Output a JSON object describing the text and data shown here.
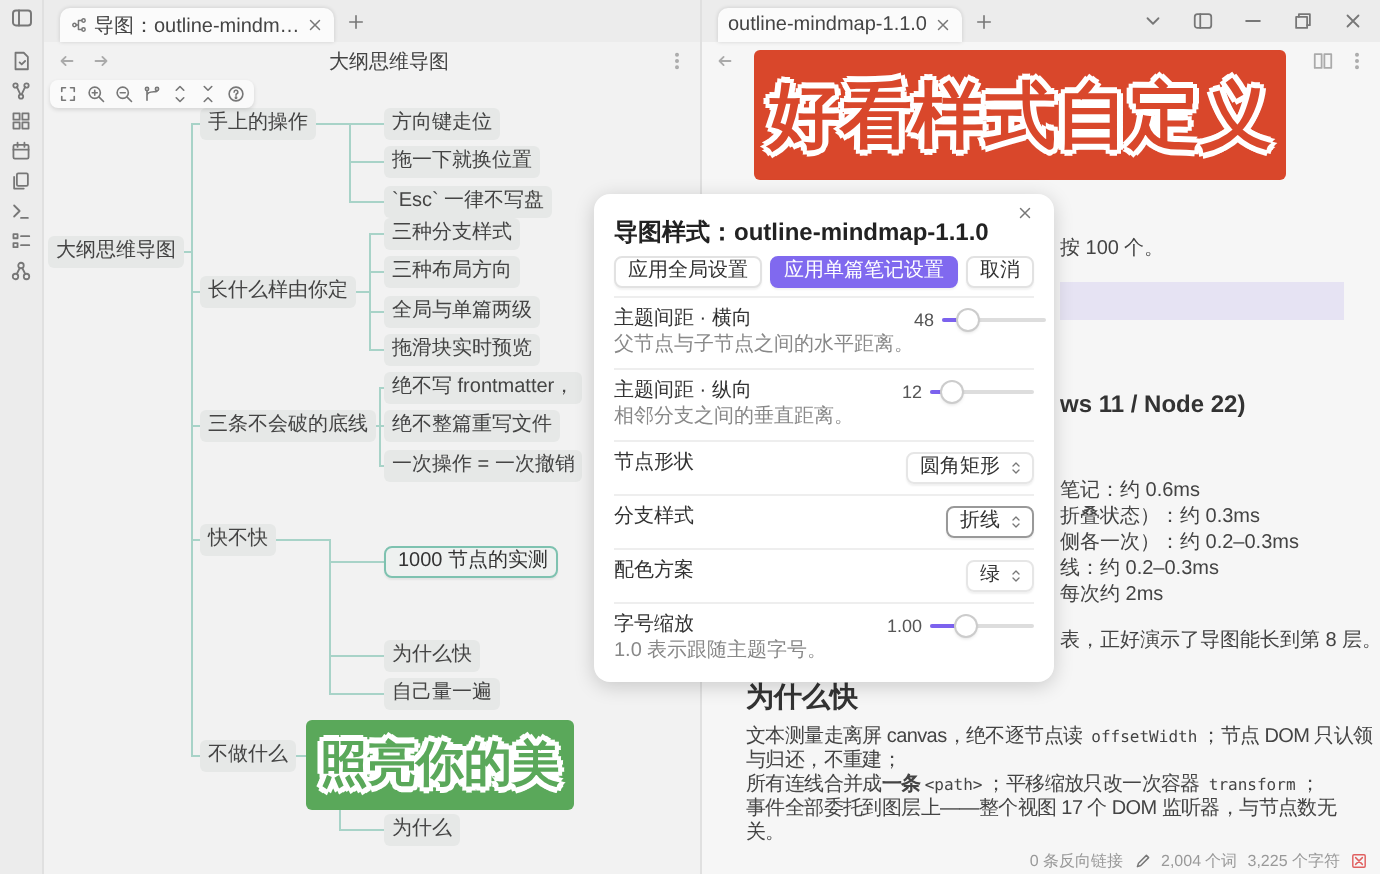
{
  "left_tabs": [
    {
      "title": "导图：outline-mindm…",
      "selected": true
    }
  ],
  "left_header": {
    "title": "大纲思维导图"
  },
  "mindmap": {
    "text": "大纲思维导图",
    "selected": false,
    "children": [
      {
        "text": "手上的操作",
        "selected": false,
        "children": [
          {
            "text": "方向键走位",
            "selected": false
          },
          {
            "text": "拖一下就换位置",
            "selected": false
          },
          {
            "text": "`Esc` 一律不写盘",
            "selected": false
          }
        ]
      },
      {
        "text": "长什么样由你定",
        "selected": false,
        "children": [
          {
            "text": "三种分支样式",
            "selected": false
          },
          {
            "text": "三种布局方向",
            "selected": false
          },
          {
            "text": "全局与单篇两级",
            "selected": false
          },
          {
            "text": "拖滑块实时预览",
            "selected": false
          }
        ]
      },
      {
        "text": "三条不会破的底线",
        "selected": false,
        "children": [
          {
            "text": "绝不写 frontmatter，",
            "selected": false
          },
          {
            "text": "绝不整篇重写文件",
            "selected": false
          },
          {
            "text": "一次操作 = 一次撤销",
            "selected": false
          }
        ]
      },
      {
        "text": "快不快",
        "selected": false,
        "children": [
          {
            "text": "1000 节点的实测",
            "selected": true
          },
          {
            "text": "为什么快",
            "selected": false
          },
          {
            "text": "自己量一遍",
            "selected": false
          }
        ]
      },
      {
        "text": "不做什么",
        "selected": false,
        "children": [
          {
            "text": "为什么",
            "selected": false
          }
        ]
      }
    ]
  },
  "right_tabs": [
    {
      "title": "outline-mindmap-1.1.0",
      "selected": true
    }
  ],
  "note": {
    "intro": "按 100 个。",
    "subheading": "ws 11 / Node 22)",
    "lines": [
      "笔记：约 0.6ms",
      "折叠状态）：约 0.3ms",
      "侧各一次）：约 0.2–0.3ms",
      "线：约 0.2–0.3ms",
      "每次约 2ms"
    ],
    "after": "表，正好演示了导图能长到第 8 层。",
    "heading": "为什么快",
    "paragraphs": [
      [
        {
          "kind": "text",
          "text": "文本测量走离屏 canvas，绝不逐节点读 "
        },
        {
          "kind": "code",
          "text": "offsetWidth"
        },
        {
          "kind": "text",
          "text": "；节点 DOM 只认领与归还，不重建；"
        }
      ],
      [
        {
          "kind": "text",
          "text": "所有连线合并成"
        },
        {
          "kind": "bold",
          "text": "一条"
        },
        {
          "kind": "code",
          "text": "<path>"
        },
        {
          "kind": "text",
          "text": "；平移缩放只改一次容器 "
        },
        {
          "kind": "code",
          "text": "transform"
        },
        {
          "kind": "text",
          "text": "；"
        }
      ],
      [
        {
          "kind": "text",
          "text": "事件全部委托到图层上——整个视图 17 个 DOM 监听器，与节点数无关。"
        }
      ]
    ]
  },
  "dialog": {
    "title": "导图样式：outline-mindmap-1.1.0",
    "buttons": [
      {
        "label": "应用全局设置",
        "selected": false
      },
      {
        "label": "应用单篇笔记设置",
        "selected": true
      },
      {
        "label": "取消",
        "selected": false
      }
    ],
    "rows": [
      {
        "kind": "slider",
        "label": "主题间距 · 横向",
        "description": "父节点与子节点之间的水平距离。",
        "value": "48",
        "level": 0.2
      },
      {
        "kind": "slider",
        "label": "主题间距 · 纵向",
        "description": "相邻分支之间的垂直距离。",
        "value": "12",
        "level": 0.15
      },
      {
        "kind": "select",
        "label": "节点形状",
        "value": "圆角矩形",
        "focused": false
      },
      {
        "kind": "select",
        "label": "分支样式",
        "value": "折线",
        "focused": true
      },
      {
        "kind": "select",
        "label": "配色方案",
        "value": "绿",
        "focused": false
      },
      {
        "kind": "slider",
        "label": "字号缩放",
        "description": "1.0 表示跟随主题字号。",
        "value": "1.00",
        "level": 0.3
      }
    ]
  },
  "status_bar": {
    "backlinks": "0 条反向链接",
    "words": "2,004 个词",
    "characters": "3,225 个字符"
  },
  "stickers": [
    {
      "text": "好看样式自定义",
      "color": "#d9472b"
    },
    {
      "text": "照亮你的美",
      "color": "#5aa85a"
    }
  ]
}
